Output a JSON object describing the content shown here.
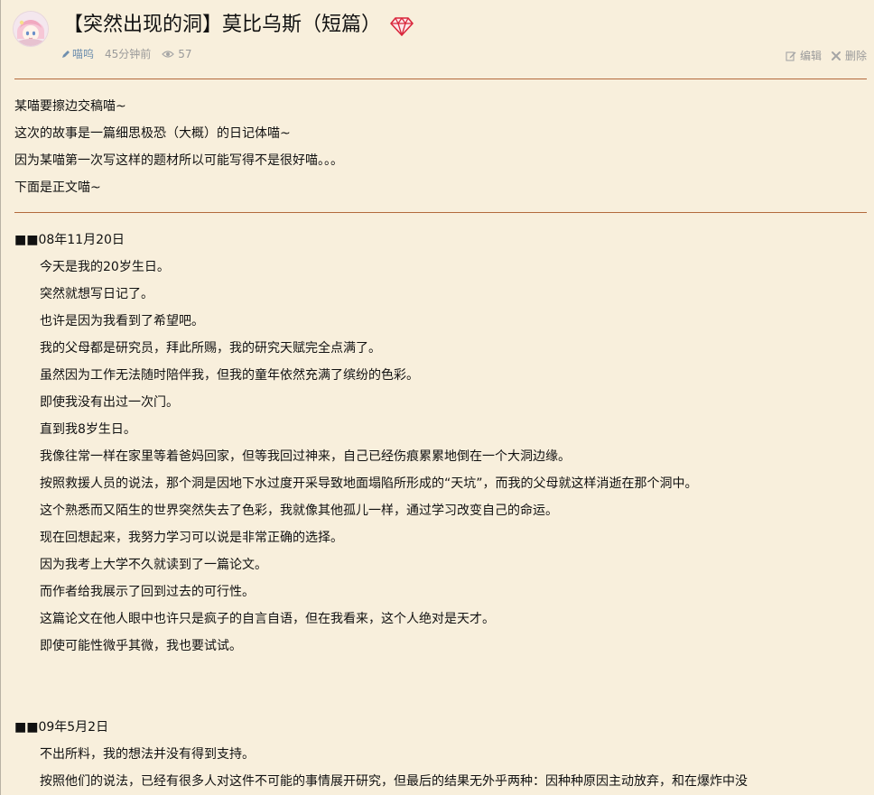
{
  "post": {
    "title": "【突然出现的洞】莫比乌斯（短篇）",
    "author": "喵呜",
    "time": "45分钟前",
    "views": "57",
    "edit_label": "编辑",
    "delete_label": "删除"
  },
  "intro": [
    "某喵要擦边交稿喵~",
    "这次的故事是一篇细思极恐（大概）的日记体喵~",
    "因为某喵第一次写这样的题材所以可能写得不是很好喵。。。",
    "下面是正文喵~"
  ],
  "entries": [
    {
      "date": "■■08年11月20日",
      "lines": [
        "今天是我的20岁生日。",
        "突然就想写日记了。",
        "也许是因为我看到了希望吧。",
        "我的父母都是研究员，拜此所赐，我的研究天赋完全点满了。",
        "虽然因为工作无法随时陪伴我，但我的童年依然充满了缤纷的色彩。",
        "即使我没有出过一次门。",
        "直到我8岁生日。",
        "我像往常一样在家里等着爸妈回家，但等我回过神来，自己已经伤痕累累地倒在一个大洞边缘。",
        "按照救援人员的说法，那个洞是因地下水过度开采导致地面塌陷所形成的“天坑”，而我的父母就这样消逝在那个洞中。",
        "这个熟悉而又陌生的世界突然失去了色彩，我就像其他孤儿一样，通过学习改变自己的命运。",
        "现在回想起来，我努力学习可以说是非常正确的选择。",
        "因为我考上大学不久就读到了一篇论文。",
        "而作者给我展示了回到过去的可行性。",
        "这篇论文在他人眼中也许只是疯子的自言自语，但在我看来，这个人绝对是天才。",
        "即使可能性微乎其微，我也要试试。"
      ]
    },
    {
      "date": "■■09年5月2日",
      "lines": [
        "不出所料，我的想法并没有得到支持。",
        "按照他们的说法，已经有很多人对这件不可能的事情展开研究，但最后的结果无外乎两种：因种种原因主动放弃，和在爆炸中没"
      ]
    }
  ],
  "colors": {
    "background": "#f8efdc",
    "rule": "#b36a3c",
    "meta_text": "#9a9a9a",
    "author": "#6f8fae",
    "gem": "#d9263b"
  },
  "icons": {
    "avatar": "avatar",
    "gem": "gem-icon",
    "pen": "pen-icon",
    "eye": "eye-icon",
    "edit": "edit-icon",
    "delete": "close-icon"
  }
}
